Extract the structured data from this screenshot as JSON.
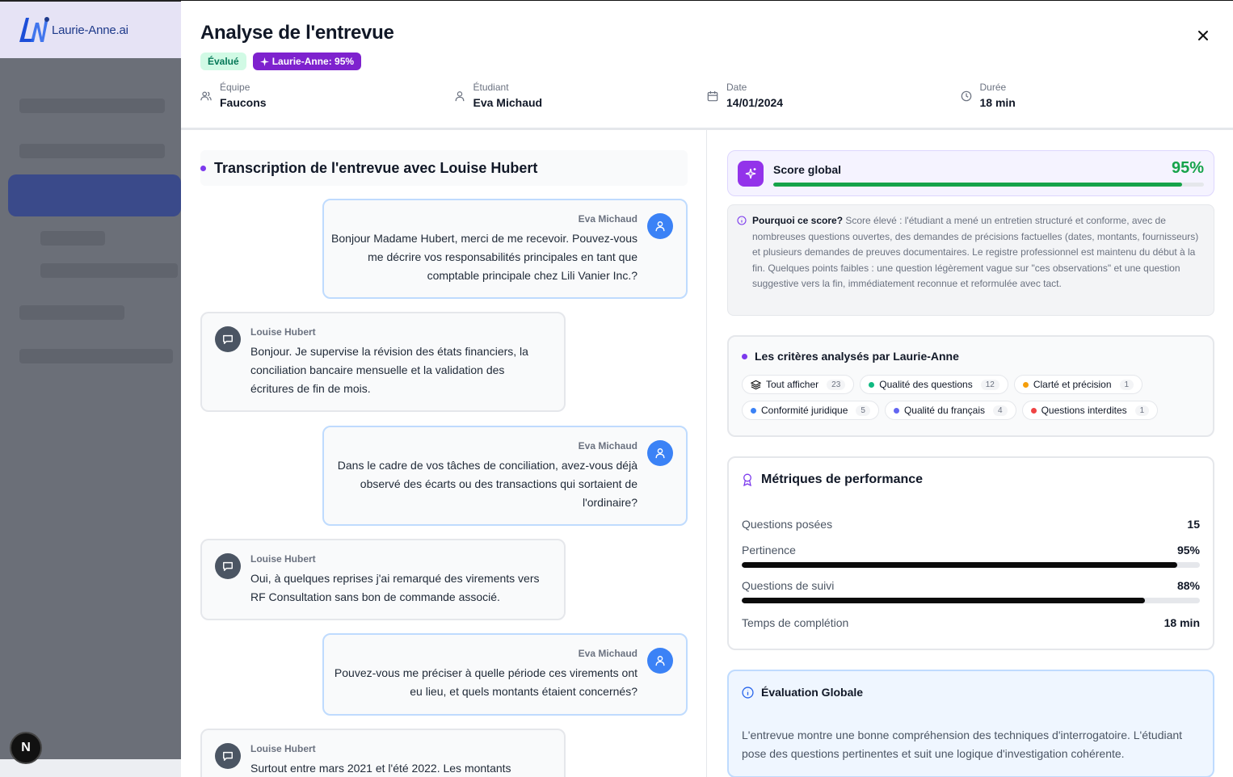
{
  "app": {
    "logo_text": "Laurie-Anne.ai",
    "n_badge": "N"
  },
  "modal": {
    "title": "Analyse de l'entrevue",
    "badge_status": "Évalué",
    "badge_ai": "Laurie-Anne: 95%",
    "close_icon": "close-icon",
    "meta": [
      {
        "label": "Équipe",
        "value": "Faucons",
        "icon": "users-icon"
      },
      {
        "label": "Étudiant",
        "value": "Eva Michaud",
        "icon": "user-icon"
      },
      {
        "label": "Date",
        "value": "14/01/2024",
        "icon": "calendar-icon"
      },
      {
        "label": "Durée",
        "value": "18 min",
        "icon": "clock-icon"
      }
    ]
  },
  "transcript": {
    "title": "Transcription de l'entrevue avec Louise Hubert",
    "messages": [
      {
        "role": "interviewer",
        "name": "Eva Michaud",
        "text": "Bonjour Madame Hubert, merci de me recevoir. Pouvez-vous me décrire vos responsabilités principales en tant que comptable principale chez Lili Vanier Inc.?"
      },
      {
        "role": "interviewee",
        "name": "Louise Hubert",
        "text": "Bonjour. Je supervise la révision des états financiers, la conciliation bancaire mensuelle et la validation des écritures de fin de mois."
      },
      {
        "role": "interviewer",
        "name": "Eva Michaud",
        "text": "Dans le cadre de vos tâches de conciliation, avez-vous déjà observé des écarts ou des transactions qui sortaient de l'ordinaire?"
      },
      {
        "role": "interviewee",
        "name": "Louise Hubert",
        "text": "Oui, à quelques reprises j'ai remarqué des virements vers RF Consultation sans bon de commande associé."
      },
      {
        "role": "interviewer",
        "name": "Eva Michaud",
        "text": "Pouvez-vous me préciser à quelle période ces virements ont eu lieu, et quels montants étaient concernés?"
      },
      {
        "role": "interviewee",
        "name": "Louise Hubert",
        "text": "Surtout entre mars 2021 et l'été 2022. Les montants"
      }
    ]
  },
  "score": {
    "label": "Score global",
    "value": "95%",
    "percent": 95,
    "color": "#16a34a",
    "why_title": "Pourquoi ce score?",
    "why_text": "Score élevé : l'étudiant a mené un entretien structuré et conforme, avec de nombreuses questions ouvertes, des demandes de précisions factuelles (dates, montants, fournisseurs) et plusieurs demandes de preuves documentaires. Le registre professionnel est maintenu du début à la fin. Quelques points faibles : une question légèrement vague sur \"ces observations\" et une question suggestive vers la fin, immédiatement reconnue et reformulée avec tact."
  },
  "criteria": {
    "title": "Les critères analysés par Laurie-Anne",
    "chips": [
      {
        "label": "Tout afficher",
        "count": "23",
        "icon": "layers-icon"
      },
      {
        "label": "Qualité des questions",
        "count": "12",
        "color": "#10b981"
      },
      {
        "label": "Clarté et précision",
        "count": "1",
        "color": "#f59e0b"
      },
      {
        "label": "Conformité juridique",
        "count": "5",
        "color": "#3b82f6"
      },
      {
        "label": "Qualité du français",
        "count": "4",
        "color": "#6366f1"
      },
      {
        "label": "Questions interdites",
        "count": "1",
        "color": "#ef4444"
      }
    ]
  },
  "metrics": {
    "title": "Métriques de performance",
    "rows": [
      {
        "label": "Questions posées",
        "value": "15"
      },
      {
        "label": "Pertinence",
        "value": "95%",
        "percent": 95
      },
      {
        "label": "Questions de suivi",
        "value": "88%",
        "percent": 88
      },
      {
        "label": "Temps de complétion",
        "value": "18 min"
      }
    ]
  },
  "evaluation": {
    "title": "Évaluation Globale",
    "text": "L'entrevue montre une bonne compréhension des techniques d'interrogatoire. L'étudiant pose des questions pertinentes et suit une logique d'investigation cohérente."
  }
}
